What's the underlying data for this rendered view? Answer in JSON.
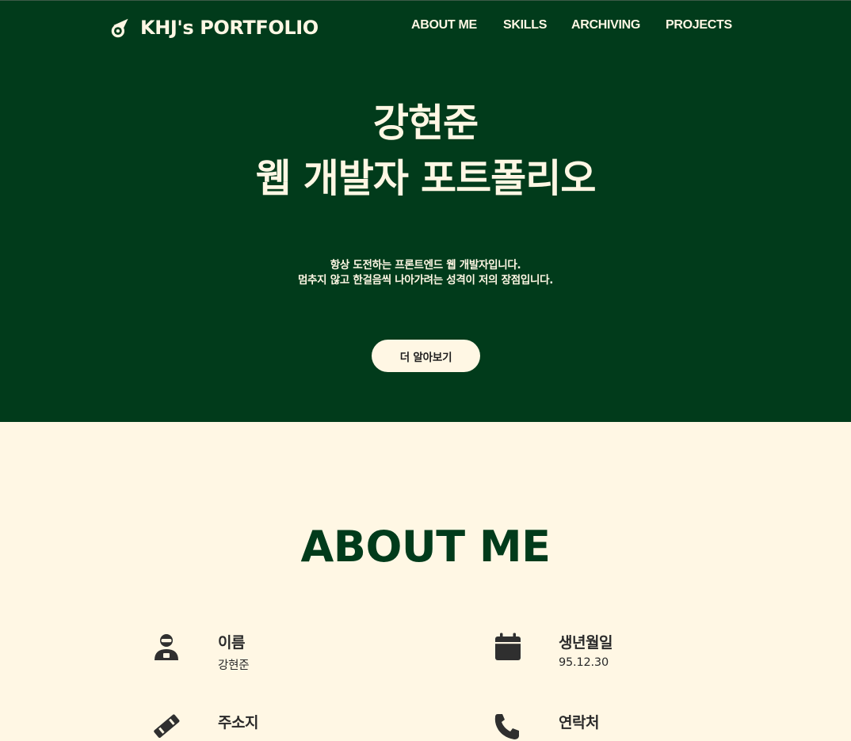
{
  "colors": {
    "hero_bg": "#013b1b",
    "cream": "#fff7e4",
    "icon": "#2f2f2f",
    "text_dark": "#2a2a2a"
  },
  "header": {
    "brand_icon": "meteor-icon",
    "brand": "KHJ's PORTFOLIO",
    "nav": [
      "ABOUT ME",
      "SKILLS",
      "ARCHIVING",
      "PROJECTS"
    ]
  },
  "hero": {
    "title_lines": [
      "강현준",
      "웹 개발자 포트폴리오"
    ],
    "description_lines": [
      "항상 도전하는 프론트엔드 웹 개발자입니다.",
      "멈추지 않고 한걸음씩 나아가려는 성격이 저의 장점입니다."
    ],
    "cta": "더 알아보기"
  },
  "about": {
    "title": "ABOUT ME",
    "items": [
      {
        "icon": "person-icon",
        "label": "이름",
        "value": "강현준"
      },
      {
        "icon": "calendar-icon",
        "label": "생년월일",
        "value": "95.12.30"
      },
      {
        "icon": "location-pin-icon",
        "label": "주소지",
        "value": ""
      },
      {
        "icon": "phone-icon",
        "label": "연락처",
        "value": ""
      }
    ]
  }
}
